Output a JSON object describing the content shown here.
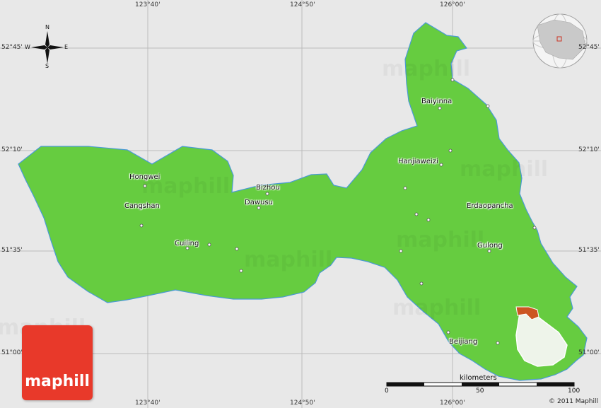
{
  "map": {
    "title": "",
    "colors": {
      "land": "#66cc40",
      "background": "#e8e8e8",
      "inset_highlight": "#cc5522",
      "logo": "#e8392a"
    },
    "coordinates": {
      "lon_top": [
        "123°40'",
        "124°50'",
        "126°00'"
      ],
      "lon_bottom": [
        "123°40'",
        "124°50'",
        "126°00'"
      ],
      "lat_left": [
        "52°45'",
        "52°10'",
        "51°35'",
        "51°00'"
      ],
      "lat_right": [
        "52°45'",
        "52°10'",
        "51°35'",
        "51°00'"
      ]
    },
    "compass": {
      "n": "N",
      "s": "S",
      "e": "E",
      "w": "W"
    },
    "cities": {
      "baiyinna": "Baiyinna",
      "hanjiaweizi": "Hanjiaweizi",
      "hongwei": "Hongwei",
      "bizhou": "Bizhou",
      "dawusu": "Dawusu",
      "cangshan": "Cangshan",
      "erdaopancha": "Erdaopancha",
      "cuiling": "Cuiling",
      "gulong": "Gulong",
      "beijiang": "Beijiang"
    },
    "scale": {
      "unit": "kilometers",
      "ticks": [
        "0",
        "50",
        "100"
      ]
    },
    "logo_text": "maphill",
    "watermark_text": "maphill",
    "copyright": "© 2011 Maphill"
  }
}
